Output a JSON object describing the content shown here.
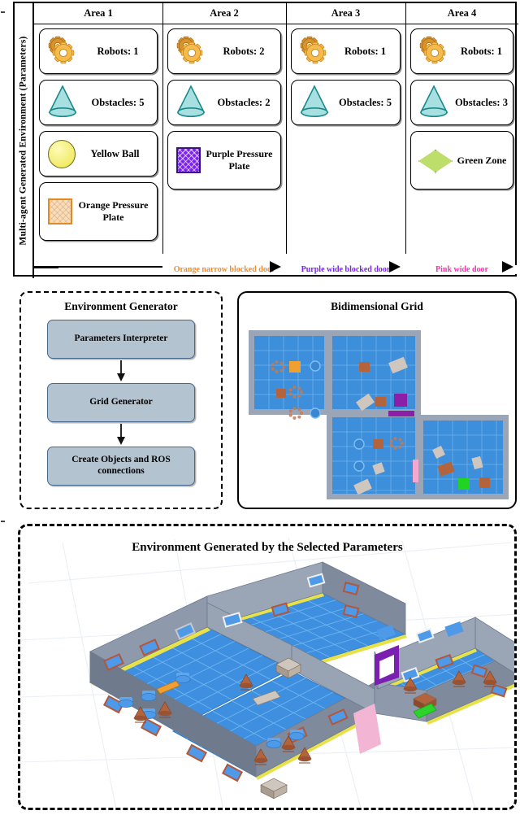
{
  "figure": {
    "section_label": "Multi-agent Generated Environment (Parameters)"
  },
  "params_table": {
    "columns": [
      {
        "header": "Area 1",
        "items": [
          {
            "icon": "gear-icon",
            "label": "Robots: 1",
            "multiline": false
          },
          {
            "icon": "cone-icon",
            "label": "Obstacles: 5",
            "multiline": false
          },
          {
            "icon": "yellow-ball-icon",
            "label": "Yellow Ball",
            "multiline": false
          },
          {
            "icon": "orange-pressure-plate-icon",
            "label": "Orange Pressure Plate",
            "multiline": true
          }
        ]
      },
      {
        "header": "Area 2",
        "items": [
          {
            "icon": "gear-icon",
            "label": "Robots: 2",
            "multiline": false
          },
          {
            "icon": "cone-icon",
            "label": "Obstacles: 2",
            "multiline": false
          },
          {
            "icon": "purple-pressure-plate-icon",
            "label": "Purple Pressure Plate",
            "multiline": true
          }
        ]
      },
      {
        "header": "Area 3",
        "items": [
          {
            "icon": "gear-icon",
            "label": "Robots: 1",
            "multiline": false
          },
          {
            "icon": "cone-icon",
            "label": "Obstacles: 5",
            "multiline": false
          }
        ]
      },
      {
        "header": "Area 4",
        "items": [
          {
            "icon": "gear-icon",
            "label": "Robots: 1",
            "multiline": false
          },
          {
            "icon": "cone-icon",
            "label": "Obstacles: 3",
            "multiline": false
          },
          {
            "icon": "green-zone-icon",
            "label": "Green Zone",
            "multiline": true
          }
        ]
      }
    ]
  },
  "doors": [
    {
      "label": "Orange narrow blocked door",
      "color": "#F28C28"
    },
    {
      "label": "Purple wide blocked door",
      "color": "#7B22F0"
    },
    {
      "label": "Pink wide door",
      "color": "#FF2FB0"
    }
  ],
  "environment_generator": {
    "title": "Environment Generator",
    "steps": [
      "Parameters Interpreter",
      "Grid Generator",
      "Create Objects and ROS connections"
    ]
  },
  "bidimensional_grid": {
    "title": "Bidimensional Grid",
    "floor_color": "#3d8fdb",
    "wall_color": "#9aa6b8",
    "markers": [
      {
        "name": "orange-pressure-plate",
        "color": "#f0a030"
      },
      {
        "name": "purple-pressure-plate",
        "color": "#8b1fa8"
      },
      {
        "name": "purple-door",
        "color": "#8b1fa8"
      },
      {
        "name": "pink-door",
        "color": "#f4a8d0"
      },
      {
        "name": "green-zone",
        "color": "#22d422"
      }
    ]
  },
  "simulation": {
    "title": "Environment Generated by the Selected Parameters",
    "floor_color": "#3f8fe0",
    "wall_color": "#8e99ab",
    "baseboard_color": "#e8e24a",
    "purple_door_color": "#7a1fb0",
    "pink_door_color": "#f3b5d4",
    "green_zone_color": "#2ad42a"
  },
  "colors": {
    "gear": "#f0b03c",
    "cone_fill": "#a8dfe0",
    "cone_stroke": "#1a8a8a",
    "ball": "#f4ed72",
    "orange_plate": "#e08a24",
    "purple_plate": "#7b22f0",
    "green_zone": "#bede6c",
    "flowbox_fill": "#b4c3d0",
    "flowbox_stroke": "#46698c"
  }
}
